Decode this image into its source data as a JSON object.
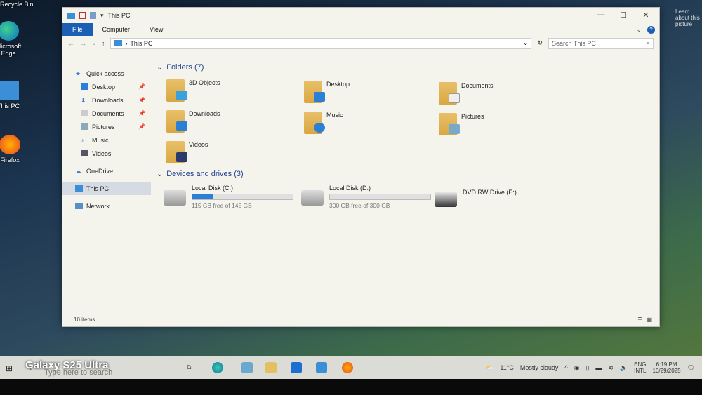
{
  "desktop": {
    "icons": [
      {
        "label": "Recycle Bin"
      },
      {
        "label": "Microsoft Edge"
      },
      {
        "label": "This PC"
      },
      {
        "label": "Firefox"
      }
    ],
    "learn_text": "Learn about this picture"
  },
  "window": {
    "title": "This PC",
    "ribbon_tabs": [
      "File",
      "Computer",
      "View"
    ],
    "address": {
      "path": "This PC",
      "search_placeholder": "Search This PC"
    },
    "nav": {
      "quick_access": "Quick access",
      "quick_items": [
        "Desktop",
        "Downloads",
        "Documents",
        "Pictures",
        "Music",
        "Videos"
      ],
      "onedrive": "OneDrive",
      "this_pc": "This PC",
      "network": "Network"
    },
    "folders_header": "Folders (7)",
    "folders": [
      "3D Objects",
      "Desktop",
      "Documents",
      "Downloads",
      "Music",
      "Pictures",
      "Videos"
    ],
    "drives_header": "Devices and drives (3)",
    "drives": [
      {
        "name": "Local Disk (C:)",
        "free": "115 GB free of 145 GB",
        "used_fraction": 0.21
      },
      {
        "name": "Local Disk (D:)",
        "free": "300 GB free of 300 GB",
        "used_fraction": 0.0
      },
      {
        "name": "DVD RW Drive (E:)"
      }
    ],
    "status": "10 items"
  },
  "taskbar": {
    "search_placeholder": "Type here to search",
    "weather": "11°C",
    "weather_desc": "Mostly cloudy",
    "lang1": "ENG",
    "lang2": "INTL",
    "time": "6:19 PM",
    "date": "10/29/2025"
  },
  "overlay": "Galaxy S25 Ultra",
  "colors": {
    "accent": "#1a5fb4",
    "bar": "#2b7fd4"
  }
}
